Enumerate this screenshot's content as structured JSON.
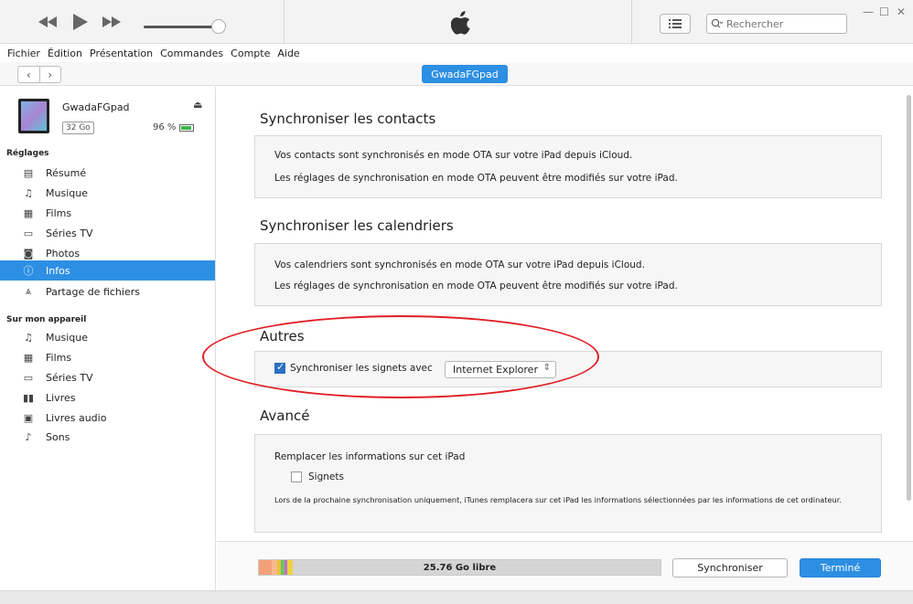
{
  "player": {
    "search_placeholder": "Rechercher",
    "volume_level": 0.93
  },
  "menu": [
    "Fichier",
    "Édition",
    "Présentation",
    "Commandes",
    "Compte",
    "Aide"
  ],
  "nav": {
    "device_label": "GwadaFGpad"
  },
  "device": {
    "name": "GwadaFGpad",
    "capacity": "32 Go",
    "battery": "96 %"
  },
  "sidebar": {
    "settings_header": "Réglages",
    "settings_items": [
      {
        "label": "Résumé",
        "icon": "summary-icon"
      },
      {
        "label": "Musique",
        "icon": "music-icon"
      },
      {
        "label": "Films",
        "icon": "film-icon"
      },
      {
        "label": "Séries TV",
        "icon": "tv-icon"
      },
      {
        "label": "Photos",
        "icon": "camera-icon"
      },
      {
        "label": "Infos",
        "icon": "info-icon",
        "active": true
      },
      {
        "label": "Partage de fichiers",
        "icon": "apps-icon"
      }
    ],
    "device_header": "Sur mon appareil",
    "device_items": [
      {
        "label": "Musique",
        "icon": "music-icon"
      },
      {
        "label": "Films",
        "icon": "film-icon"
      },
      {
        "label": "Séries TV",
        "icon": "tv-icon"
      },
      {
        "label": "Livres",
        "icon": "book-icon"
      },
      {
        "label": "Livres audio",
        "icon": "audiobook-icon"
      },
      {
        "label": "Sons",
        "icon": "bell-icon"
      }
    ]
  },
  "main": {
    "contacts": {
      "title": "Synchroniser les contacts",
      "line1": "Vos contacts sont synchronisés en mode OTA sur votre iPad depuis iCloud.",
      "line2": "Les réglages de synchronisation en mode OTA peuvent être modifiés sur votre iPad."
    },
    "calendars": {
      "title": "Synchroniser les calendriers",
      "line1": "Vos calendriers sont synchronisés en mode OTA sur votre iPad depuis iCloud.",
      "line2": "Les réglages de synchronisation en mode OTA peuvent être modifiés sur votre iPad."
    },
    "other": {
      "title": "Autres",
      "bookmarks_label": "Synchroniser les signets avec",
      "bookmarks_checked": true,
      "browser": "Internet Explorer"
    },
    "advanced": {
      "title": "Avancé",
      "replace_label": "Remplacer les informations sur cet iPad",
      "bookmarks_option": "Signets",
      "bookmarks_option_checked": false,
      "note": "Lors de la prochaine synchronisation uniquement, iTunes remplacera sur cet iPad les informations sélectionnées par les informations de cet ordinateur."
    }
  },
  "footer": {
    "free_space": "25.76 Go libre",
    "sync_button": "Synchroniser",
    "done_button": "Terminé",
    "storage_colors": [
      "#f4a07a",
      "#f4a07a",
      "#e2c532",
      "#6cc46a",
      "#3fb4e0",
      "#c06fd0",
      "#f0d23c"
    ]
  },
  "colors": {
    "accent": "#2d8fe3",
    "highlight_ellipse": "#e01f26"
  }
}
